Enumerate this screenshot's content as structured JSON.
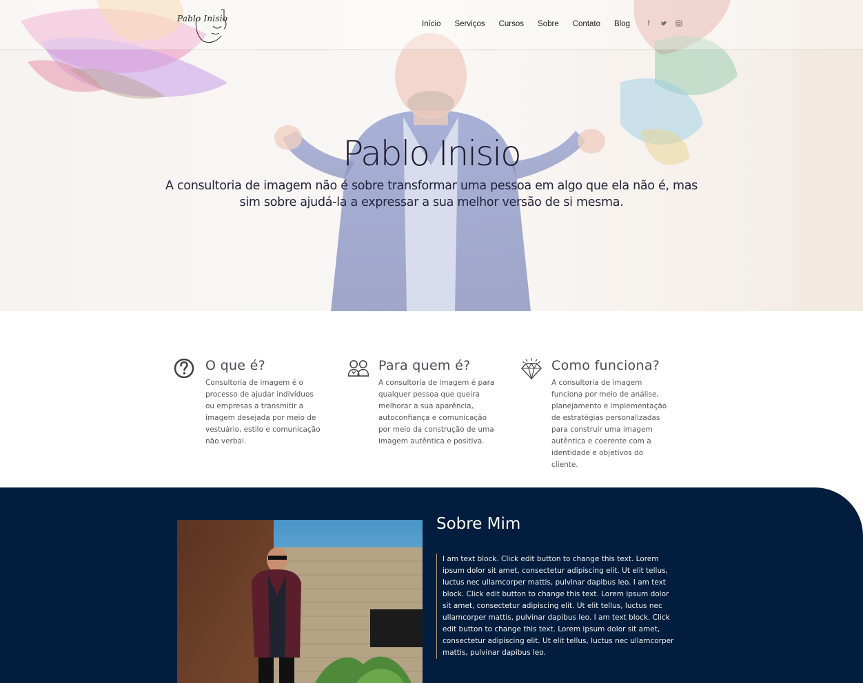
{
  "header": {
    "logo_text": "Pablo Inisio",
    "nav": [
      "Início",
      "Serviços",
      "Cursos",
      "Sobre",
      "Contato",
      "Blog"
    ],
    "social_icons": [
      "facebook-icon",
      "twitter-icon",
      "instagram-icon"
    ]
  },
  "hero": {
    "title": "Pablo Inisio",
    "subtitle": "A consultoria de imagem não é sobre transformar uma pessoa em algo que ela não é, mas sim sobre ajudá-la a expressar a sua melhor versão de si mesma."
  },
  "features": [
    {
      "icon": "question-circle-icon",
      "title": "O que é?",
      "text": "Consultoria de imagem é o processo de ajudar indivíduos ou empresas a transmitir a imagem desejada por meio de vestuário, estilo e comunicação não verbal."
    },
    {
      "icon": "people-icon",
      "title": "Para quem é?",
      "text": "A consultoria de imagem é para qualquer pessoa que queira melhorar a sua aparência, autoconfiança e comunicação por meio da construção de uma imagem autêntica e positiva."
    },
    {
      "icon": "diamond-icon",
      "title": "Como funciona?",
      "text": "A consultoria de imagem funciona por meio de análise, planejamento e implementação de estratégias personalizadas para construir uma imagem autêntica e coerente com a identidade e objetivos do cliente."
    }
  ],
  "about": {
    "title": "Sobre Mim",
    "text": "I am text block. Click edit button to change this text. Lorem ipsum dolor sit amet, consectetur adipiscing elit. Ut elit tellus, luctus nec ullamcorper mattis, pulvinar dapibus leo. I am text block. Click edit button to change this text. Lorem ipsum dolor sit amet, consectetur adipiscing elit. Ut elit tellus, luctus nec ullamcorper mattis, pulvinar dapibus leo. I am text block. Click edit button to change this text. Lorem ipsum dolor sit amet, consectetur adipiscing elit. Ut elit tellus, luctus nec ullamcorper mattis, pulvinar dapibus leo."
  },
  "colors": {
    "accent_dark_blue": "#021d3d",
    "divider_gold": "#b8a06a"
  }
}
